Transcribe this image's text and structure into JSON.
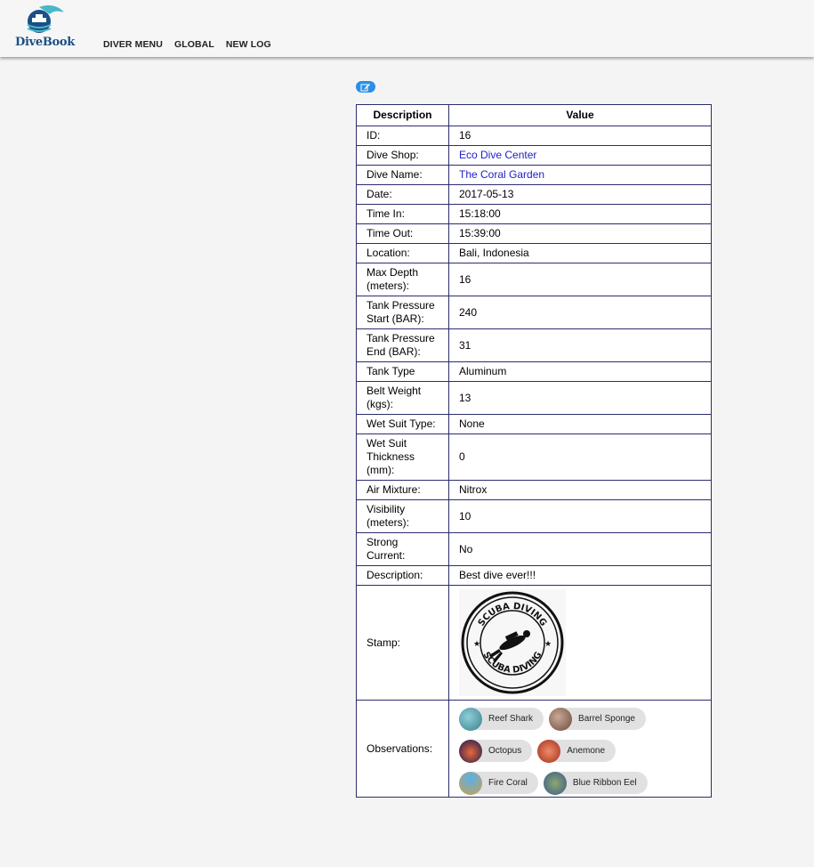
{
  "brand": {
    "name": "DiveBook"
  },
  "nav": {
    "items": [
      "DIVER MENU",
      "GLOBAL",
      "NEW LOG"
    ]
  },
  "table": {
    "headers": {
      "description": "Description",
      "value": "Value"
    },
    "rows": [
      {
        "label": "ID:",
        "value": "16"
      },
      {
        "label": "Dive Shop:",
        "value": "Eco Dive Center",
        "link": true
      },
      {
        "label": "Dive Name:",
        "value": "The Coral Garden",
        "link": true
      },
      {
        "label": "Date:",
        "value": "2017-05-13"
      },
      {
        "label": "Time In:",
        "value": "15:18:00"
      },
      {
        "label": "Time Out:",
        "value": "15:39:00"
      },
      {
        "label": "Location:",
        "value": "Bali, Indonesia"
      },
      {
        "label": "Max Depth (meters):",
        "value": "16"
      },
      {
        "label": "Tank Pressure Start (BAR):",
        "value": "240"
      },
      {
        "label": "Tank Pressure End (BAR):",
        "value": "31"
      },
      {
        "label": "Tank Type",
        "value": "Aluminum"
      },
      {
        "label": "Belt Weight (kgs):",
        "value": "13"
      },
      {
        "label": "Wet Suit Type:",
        "value": "None"
      },
      {
        "label": "Wet Suit Thickness (mm):",
        "value": "0"
      },
      {
        "label": "Air Mixture:",
        "value": "Nitrox"
      },
      {
        "label": "Visibility (meters):",
        "value": "10"
      },
      {
        "label": "Strong Current:",
        "value": "No"
      },
      {
        "label": "Description:",
        "value": "Best dive ever!!!"
      }
    ],
    "stamp": {
      "label": "Stamp:",
      "text_top": "SCUBA DIVING",
      "text_bottom": "SCUBA DIVING"
    },
    "observations": {
      "label": "Observations:",
      "items": [
        {
          "name": "Reef Shark",
          "color": "#4a8f9a"
        },
        {
          "name": "Barrel Sponge",
          "color": "#8a6a5a"
        },
        {
          "name": "Octopus",
          "color": "#1a1a6a"
        },
        {
          "name": "Anemone",
          "color": "#c8503a"
        },
        {
          "name": "Fire Coral",
          "color": "#2a8ac8"
        },
        {
          "name": "Blue Ribbon Eel",
          "color": "#5a7a4a"
        }
      ]
    }
  },
  "colors": {
    "accent": "#2a8fe6",
    "link": "#2020c8",
    "border": "#2d2d6e"
  }
}
